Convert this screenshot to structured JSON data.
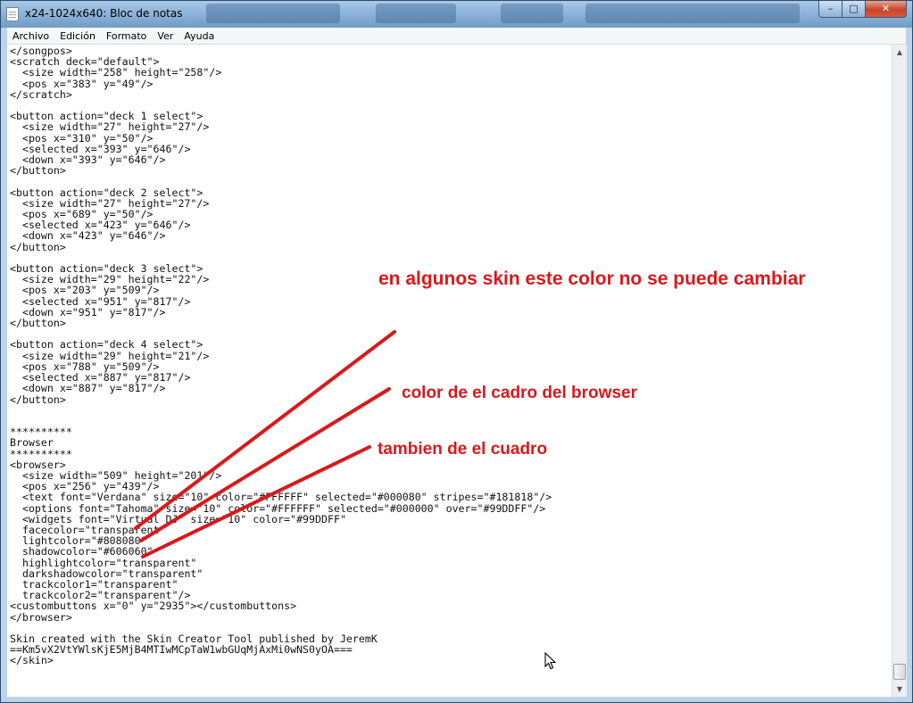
{
  "window": {
    "title": "x24-1024x640: Bloc de notas",
    "buttons": {
      "minimize": "–",
      "maximize": "□",
      "close": "✕"
    }
  },
  "menu": [
    "Archivo",
    "Edición",
    "Formato",
    "Ver",
    "Ayuda"
  ],
  "editor": {
    "lines": [
      "</songpos>",
      "<scratch deck=\"default\">",
      "  <size width=\"258\" height=\"258\"/>",
      "  <pos x=\"383\" y=\"49\"/>",
      "</scratch>",
      "",
      "<button action=\"deck 1 select\">",
      "  <size width=\"27\" height=\"27\"/>",
      "  <pos x=\"310\" y=\"50\"/>",
      "  <selected x=\"393\" y=\"646\"/>",
      "  <down x=\"393\" y=\"646\"/>",
      "</button>",
      "",
      "<button action=\"deck 2 select\">",
      "  <size width=\"27\" height=\"27\"/>",
      "  <pos x=\"689\" y=\"50\"/>",
      "  <selected x=\"423\" y=\"646\"/>",
      "  <down x=\"423\" y=\"646\"/>",
      "</button>",
      "",
      "<button action=\"deck 3 select\">",
      "  <size width=\"29\" height=\"22\"/>",
      "  <pos x=\"203\" y=\"509\"/>",
      "  <selected x=\"951\" y=\"817\"/>",
      "  <down x=\"951\" y=\"817\"/>",
      "</button>",
      "",
      "<button action=\"deck 4 select\">",
      "  <size width=\"29\" height=\"21\"/>",
      "  <pos x=\"788\" y=\"509\"/>",
      "  <selected x=\"887\" y=\"817\"/>",
      "  <down x=\"887\" y=\"817\"/>",
      "</button>",
      "",
      "",
      "**********",
      "Browser",
      "**********",
      "<browser>",
      "  <size width=\"509\" height=\"201\"/>",
      "  <pos x=\"256\" y=\"439\"/>",
      "  <text font=\"Verdana\" size=\"10\" color=\"#FFFFFF\" selected=\"#000080\" stripes=\"#181818\"/>",
      "  <options font=\"Tahoma\" size=\"10\" color=\"#FFFFFF\" selected=\"#000000\" over=\"#99DDFF\"/>",
      "  <widgets font=\"Virtual DJ\" size=\"10\" color=\"#99DDFF\"",
      "  facecolor=\"transparent\"",
      "  lightcolor=\"#808080\"",
      "  shadowcolor=\"#606060\"",
      "  highlightcolor=\"transparent\"",
      "  darkshadowcolor=\"transparent\"",
      "  trackcolor1=\"transparent\"",
      "  trackcolor2=\"transparent\"/>",
      "<custombuttons x=\"0\" y=\"2935\"></custombuttons>",
      "</browser>",
      "",
      "Skin created with the Skin Creator Tool published by JeremK",
      "==Km5vX2VtYWlsKjE5MjB4MTIwMCpTaW1wbGUqMjAxMi0wNS0yOA===",
      "</skin>"
    ]
  },
  "annotations": [
    "en algunos skin este color no se puede cambiar",
    "color de el cadro del browser",
    "tambien de el cuadro"
  ],
  "colors": {
    "annotation": "#d9191c",
    "titlebar": "#8fb4d8"
  },
  "icons": {
    "app": "notepad-icon",
    "cursor": "mouse-pointer-icon"
  }
}
